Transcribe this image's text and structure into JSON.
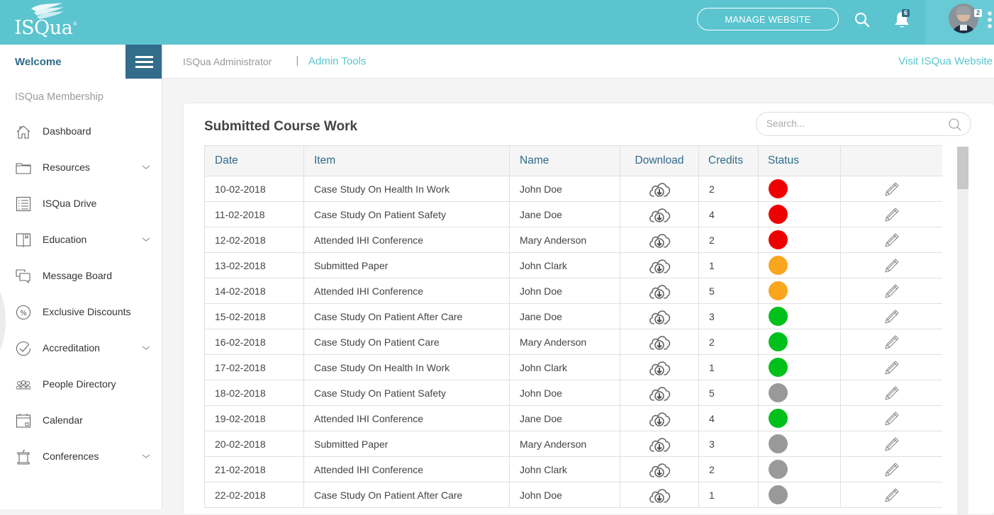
{
  "topbar": {
    "logo_text": "ISQua",
    "logo_mark": "®",
    "manage_button": "MANAGE WEBSITE",
    "notification_count": "6",
    "avatar_badge_count": "2",
    "icons": {
      "search": "search-icon",
      "bell": "bell-icon",
      "menu": "kebab-menu-icon"
    }
  },
  "sidebar": {
    "welcome": "Welcome",
    "section_title": "ISQua Membership",
    "items": [
      {
        "label": "Dashboard",
        "icon": "home-icon",
        "has_submenu": false
      },
      {
        "label": "Resources",
        "icon": "folder-icon",
        "has_submenu": true
      },
      {
        "label": "ISQua Drive",
        "icon": "list-icon",
        "has_submenu": false
      },
      {
        "label": "Education",
        "icon": "book-icon",
        "has_submenu": true
      },
      {
        "label": "Message Board",
        "icon": "chat-icon",
        "has_submenu": false
      },
      {
        "label": "Exclusive Discounts",
        "icon": "percent-icon",
        "has_submenu": false
      },
      {
        "label": "Accreditation",
        "icon": "check-circle-icon",
        "has_submenu": true
      },
      {
        "label": "People Directory",
        "icon": "people-icon",
        "has_submenu": false
      },
      {
        "label": "Calendar",
        "icon": "calendar-icon",
        "has_submenu": false
      },
      {
        "label": "Conferences",
        "icon": "podium-icon",
        "has_submenu": true
      }
    ]
  },
  "breadcrumb": {
    "root": "ISQua Administrator",
    "separator": "|",
    "current": "Admin Tools",
    "visit_link": "Visit ISQua Website"
  },
  "card": {
    "title": "Submitted Course Work",
    "search_placeholder": "Search...",
    "search_value": ""
  },
  "table": {
    "columns": [
      "Date",
      "Item",
      "Name",
      "Download",
      "Credits",
      "Status",
      ""
    ],
    "status_colors": {
      "red": "#ee0000",
      "orange": "#f9a51e",
      "green": "#00c01a",
      "gray": "#999999"
    },
    "rows": [
      {
        "date": "10-02-2018",
        "item": "Case Study On Health In Work",
        "name": "John Doe",
        "credits": "2",
        "status": "red"
      },
      {
        "date": "11-02-2018",
        "item": "Case Study On Patient Safety",
        "name": "Jane Doe",
        "credits": "4",
        "status": "red"
      },
      {
        "date": "12-02-2018",
        "item": "Attended IHI Conference",
        "name": "Mary Anderson",
        "credits": "2",
        "status": "red"
      },
      {
        "date": "13-02-2018",
        "item": "Submitted Paper",
        "name": "John Clark",
        "credits": "1",
        "status": "orange"
      },
      {
        "date": "14-02-2018",
        "item": "Attended IHI Conference",
        "name": "John Doe",
        "credits": "5",
        "status": "orange"
      },
      {
        "date": "15-02-2018",
        "item": "Case Study On Patient After Care",
        "name": "Jane Doe",
        "credits": "3",
        "status": "green"
      },
      {
        "date": "16-02-2018",
        "item": "Case Study On Patient Care",
        "name": "Mary Anderson",
        "credits": "2",
        "status": "green"
      },
      {
        "date": "17-02-2018",
        "item": "Case Study On Health In Work",
        "name": "John Clark",
        "credits": "1",
        "status": "green"
      },
      {
        "date": "18-02-2018",
        "item": "Case Study On Patient Safety",
        "name": "John Doe",
        "credits": "5",
        "status": "gray"
      },
      {
        "date": "19-02-2018",
        "item": "Attended IHI Conference",
        "name": "Jane Doe",
        "credits": "4",
        "status": "green"
      },
      {
        "date": "20-02-2018",
        "item": "Submitted Paper",
        "name": "Mary Anderson",
        "credits": "3",
        "status": "gray"
      },
      {
        "date": "21-02-2018",
        "item": "Attended IHI Conference",
        "name": "John Clark",
        "credits": "2",
        "status": "gray"
      },
      {
        "date": "22-02-2018",
        "item": "Case Study On Patient After Care",
        "name": "John Doe",
        "credits": "1",
        "status": "gray"
      }
    ]
  },
  "colors": {
    "brand": "#5bc4cf",
    "brand_dark": "#326d8b",
    "header_text": "#2e6b8a"
  }
}
